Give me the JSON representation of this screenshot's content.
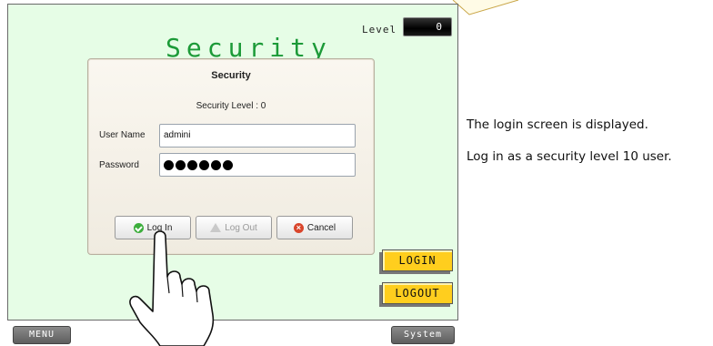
{
  "screen": {
    "title": "Security",
    "level_label": "Level",
    "level_value": "0",
    "buttons": {
      "menu": "MENU",
      "system": "System",
      "login": "LOGIN",
      "logout": "LOGOUT"
    }
  },
  "dialog": {
    "title": "Security",
    "security_level_text": "Security Level  : 0",
    "user_name_label": "User Name",
    "user_name_value": "admini",
    "password_label": "Password",
    "password_dot_count": 6,
    "buttons": {
      "log_in": "Log In",
      "log_out": "Log Out",
      "cancel": "Cancel"
    }
  },
  "instructions": [
    "The login screen is displayed.",
    "Log in as a security level 10 user."
  ],
  "colors": {
    "screen_bg": "#e6fde6",
    "title_green": "#1c9a38",
    "yellow_button": "#ffce1e"
  }
}
